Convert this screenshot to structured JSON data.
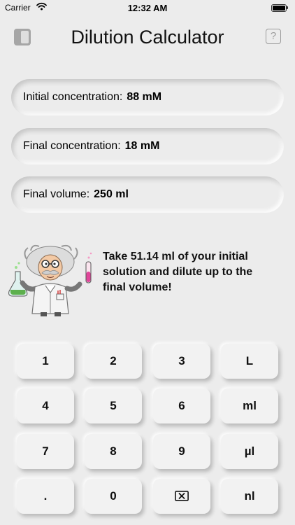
{
  "status_bar": {
    "carrier": "Carrier",
    "time": "12:32 AM",
    "battery_level": 1.0
  },
  "header": {
    "title": "Dilution Calculator",
    "left_icon": "sidebar-icon",
    "right_icon": "help-icon",
    "help_glyph": "?"
  },
  "fields": [
    {
      "label": "Initial concentration:",
      "value": "88 mM"
    },
    {
      "label": "Final concentration:",
      "value": "18 mM"
    },
    {
      "label": "Final volume:",
      "value": "250 ml"
    }
  ],
  "result": {
    "text": "Take 51.14 ml of your initial solution and dilute up to the final volume!",
    "image": "scientist-illustration"
  },
  "keypad": {
    "keys": [
      "1",
      "2",
      "3",
      "L",
      "4",
      "5",
      "6",
      "ml",
      "7",
      "8",
      "9",
      "µl",
      ".",
      "0",
      "",
      "nl"
    ],
    "backspace_icon": "backspace-icon"
  },
  "colors": {
    "background": "#ececec",
    "key_face": "#f2f2f2",
    "text": "#111111",
    "icon_gray": "#9c9c9c"
  }
}
